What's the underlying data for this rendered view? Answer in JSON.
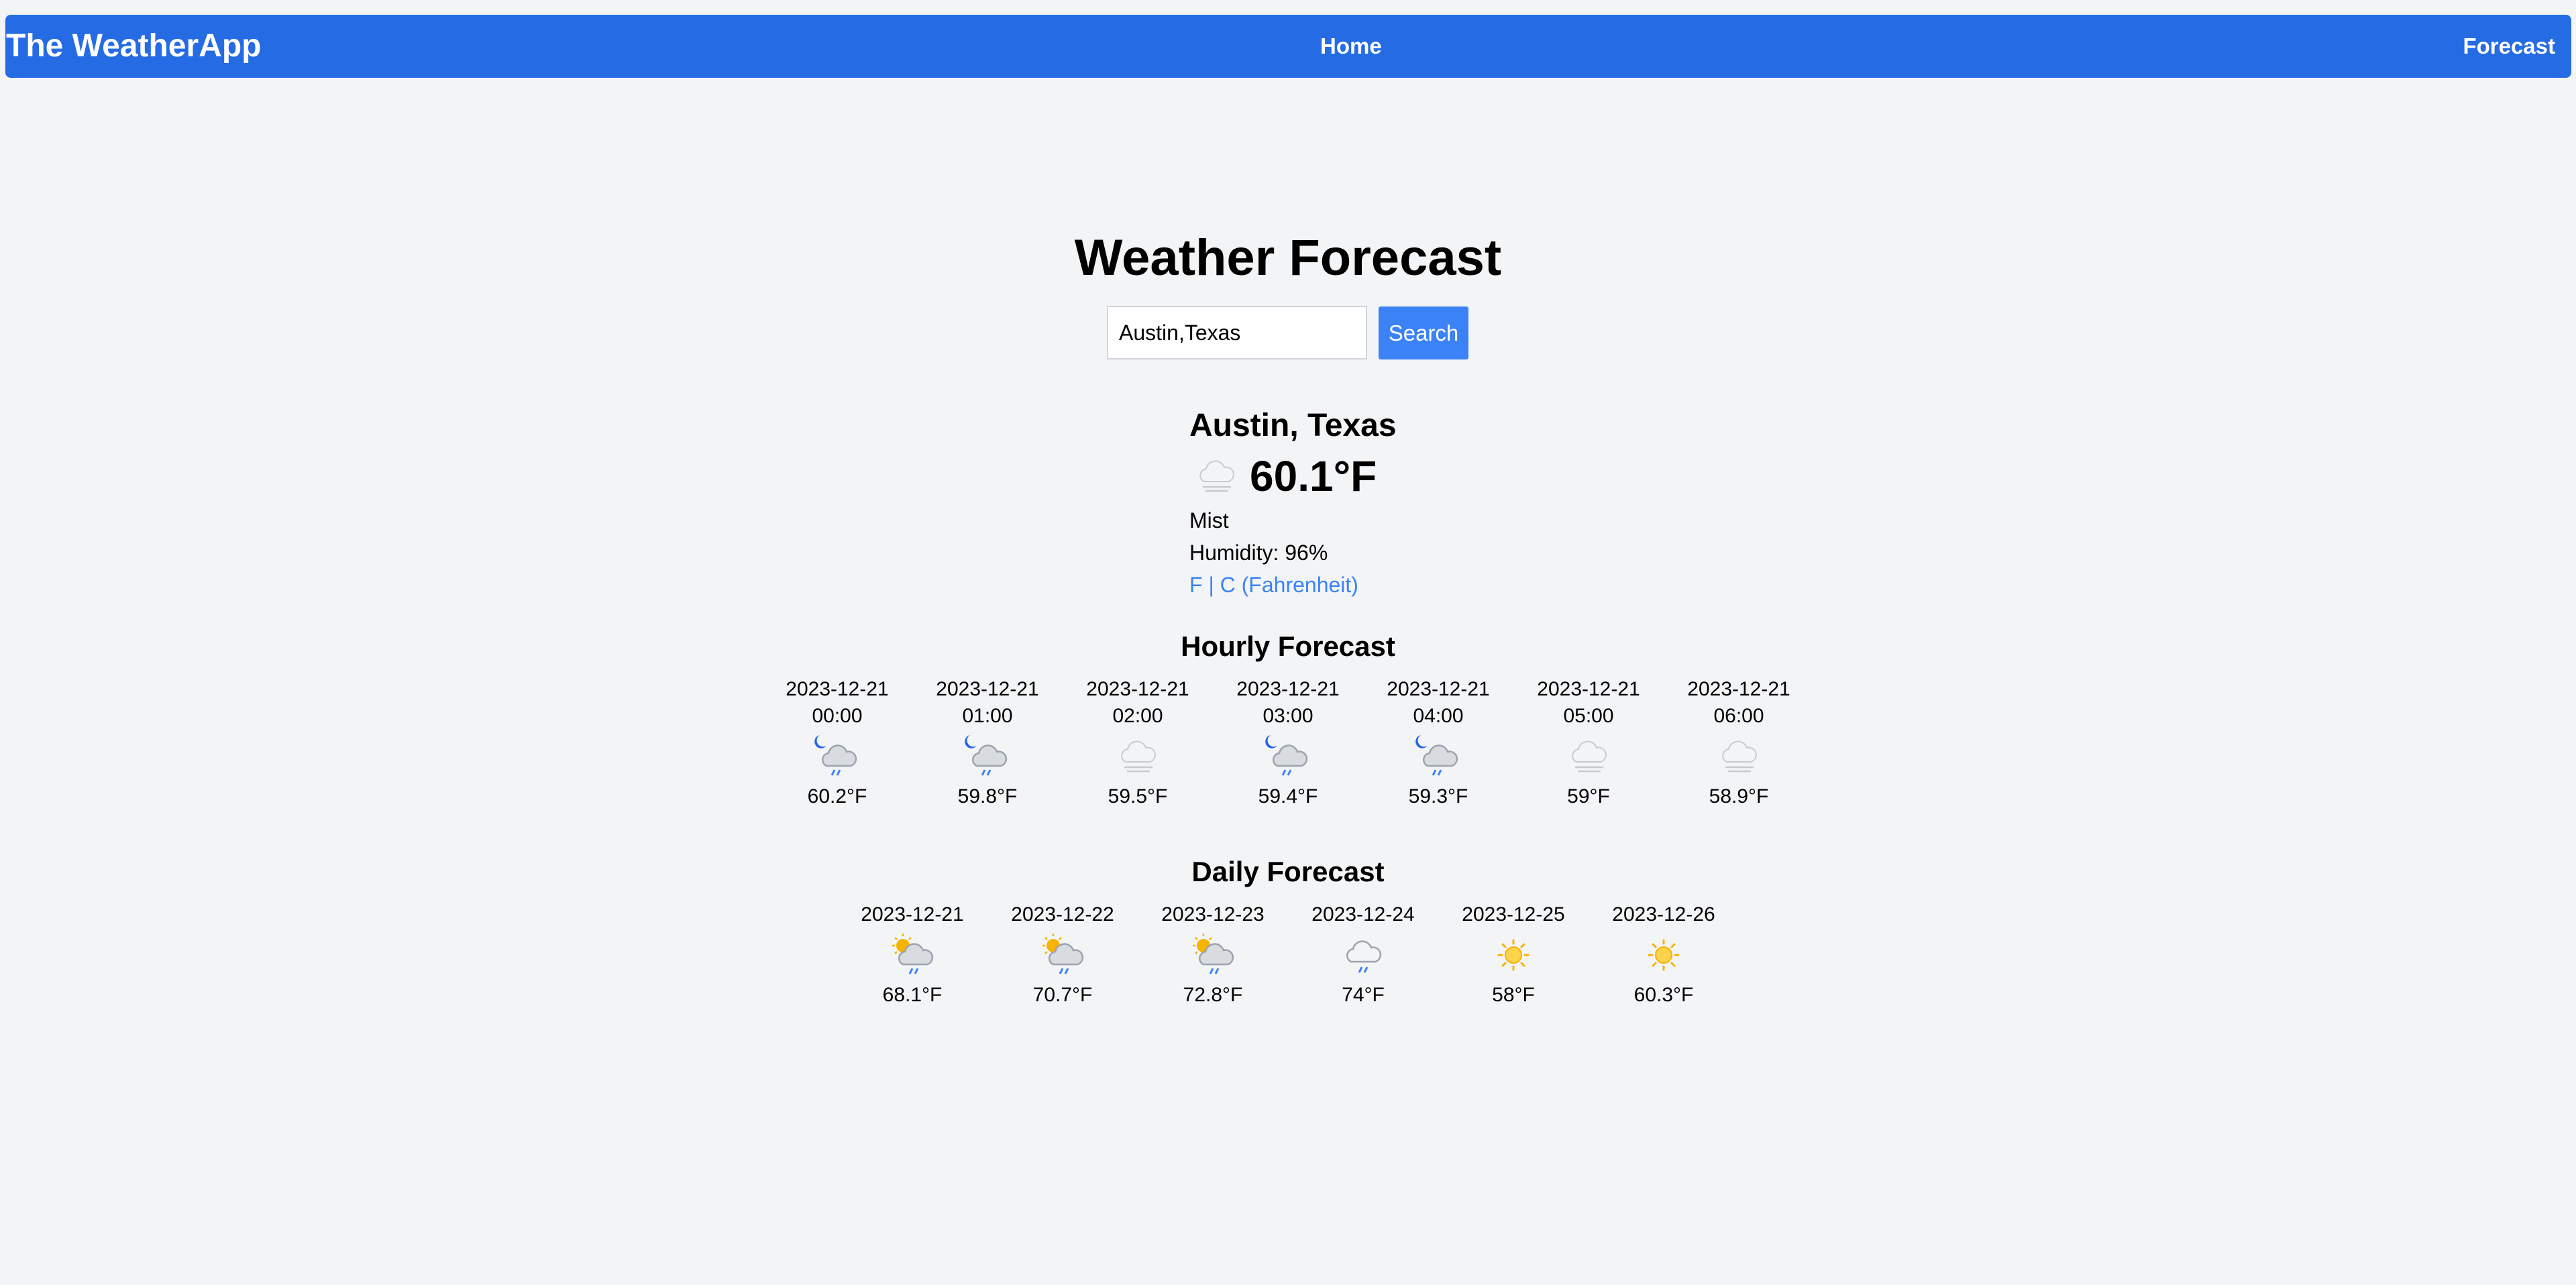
{
  "nav": {
    "brand": "The WeatherApp",
    "home": "Home",
    "forecast": "Forecast"
  },
  "page_title": "Weather Forecast",
  "search": {
    "value": "Austin,Texas",
    "button": "Search"
  },
  "current": {
    "location": "Austin, Texas",
    "temperature": "60.1°F",
    "condition": "Mist",
    "humidity": "Humidity: 96%",
    "unit_toggle": "F | C (Fahrenheit)",
    "icon": "mist-icon"
  },
  "hourly": {
    "title": "Hourly Forecast",
    "items": [
      {
        "date": "2023-12-21",
        "time": "00:00",
        "temp": "60.2°F",
        "icon": "night-rain-icon"
      },
      {
        "date": "2023-12-21",
        "time": "01:00",
        "temp": "59.8°F",
        "icon": "night-rain-icon"
      },
      {
        "date": "2023-12-21",
        "time": "02:00",
        "temp": "59.5°F",
        "icon": "mist-icon"
      },
      {
        "date": "2023-12-21",
        "time": "03:00",
        "temp": "59.4°F",
        "icon": "night-rain-icon"
      },
      {
        "date": "2023-12-21",
        "time": "04:00",
        "temp": "59.3°F",
        "icon": "night-rain-icon"
      },
      {
        "date": "2023-12-21",
        "time": "05:00",
        "temp": "59°F",
        "icon": "mist-icon"
      },
      {
        "date": "2023-12-21",
        "time": "06:00",
        "temp": "58.9°F",
        "icon": "mist-icon"
      }
    ]
  },
  "daily": {
    "title": "Daily Forecast",
    "items": [
      {
        "date": "2023-12-21",
        "temp": "68.1°F",
        "icon": "sun-cloud-rain-icon"
      },
      {
        "date": "2023-12-22",
        "temp": "70.7°F",
        "icon": "sun-cloud-rain-icon"
      },
      {
        "date": "2023-12-23",
        "temp": "72.8°F",
        "icon": "sun-cloud-rain-icon"
      },
      {
        "date": "2023-12-24",
        "temp": "74°F",
        "icon": "cloud-rain-icon"
      },
      {
        "date": "2023-12-25",
        "temp": "58°F",
        "icon": "sun-icon"
      },
      {
        "date": "2023-12-26",
        "temp": "60.3°F",
        "icon": "sun-icon"
      }
    ]
  },
  "colors": {
    "navbar": "#256be4",
    "accent": "#3b82f6",
    "background": "#f3f4f6",
    "moon": "#2563eb",
    "sun": "#f5b400",
    "cloud": "#d1d5db",
    "rain": "#3b82f6"
  }
}
